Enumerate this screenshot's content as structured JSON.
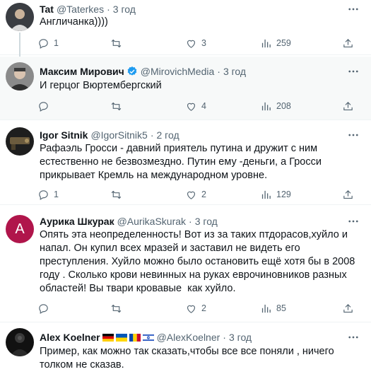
{
  "tweets": [
    {
      "name": "Tat",
      "handle": "@Taterkes",
      "time": "3 год",
      "text": "Англичанка))))",
      "replies": "1",
      "retweets": "",
      "likes": "3",
      "views": "259",
      "avatar_color": "#4b4f55"
    },
    {
      "name": "Максим Мирович",
      "handle": "@MirovichMedia",
      "time": "3 год",
      "text": "И герцог Вюртембергский",
      "replies": "",
      "retweets": "",
      "likes": "4",
      "views": "208",
      "verified_color": "#1d9bf0",
      "avatar_color": "#6b6b6b"
    },
    {
      "name": "Igor Sitnik",
      "handle": "@IgorSitnik5",
      "time": "2 год",
      "text": "Рафаэль Гросси - давний приятель путина и дружит с ним естественно не безвозмездно. Путин ему -деньги, а Гросси прикрывает Кремль на международном уровне.",
      "replies": "1",
      "retweets": "",
      "likes": "2",
      "views": "129",
      "avatar_color": "#2b2b2b"
    },
    {
      "name": "Аурика Шкурак",
      "handle": "@AurikaSkurak",
      "time": "3 год",
      "text": "Опять эта неопределенность! Вот из за таких птдорасов,хуйло и напал. Он купил всех мразей и заставил не видеть его преступления. Хуйло можно было остановить ещё хотя бы в 2008 году . Сколько крови невинных на руках еврочиновников разных областей! Вы твари кровавые  как хуйло.",
      "replies": "",
      "retweets": "",
      "likes": "2",
      "views": "85",
      "avatar_letter": "A",
      "avatar_color": "#b0154b"
    },
    {
      "name": "Alex Koelner",
      "handle": "@AlexKoelner",
      "time": "3 год",
      "text": "Пример, как можно так сказать,чтобы все все поняли , ничего толком не сказав.",
      "avatar_color": "#1a1a1a"
    }
  ]
}
